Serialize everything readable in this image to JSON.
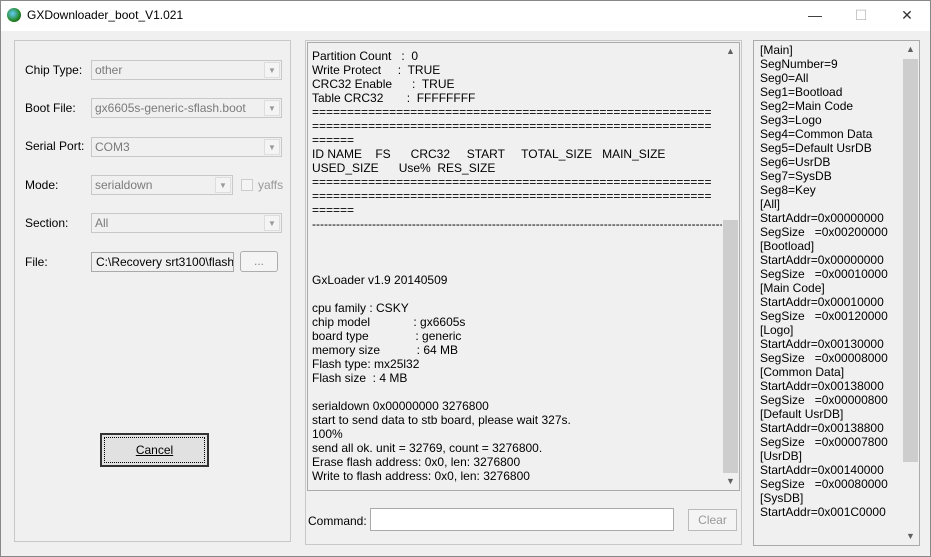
{
  "window": {
    "title": "GXDownloader_boot_V1.021",
    "minimize": "—",
    "maximize": "☐",
    "close": "✕"
  },
  "form": {
    "chip_type": {
      "label": "Chip Type:",
      "value": "other"
    },
    "boot_file": {
      "label": "Boot File:",
      "value": "gx6605s-generic-sflash.boot"
    },
    "serial_port": {
      "label": "Serial Port:",
      "value": "COM3"
    },
    "mode": {
      "label": "Mode:",
      "value": "serialdown",
      "yaffs_label": "yaffs",
      "yaffs_checked": false
    },
    "section": {
      "label": "Section:",
      "value": "All"
    },
    "file": {
      "label": "File:",
      "value": "C:\\Recovery srt3100\\flash",
      "browse": "..."
    },
    "cancel": "Cancel"
  },
  "log": {
    "lines": [
      "Partition Count   :  0",
      "Write Protect     :  TRUE",
      "CRC32 Enable      :  TRUE",
      "Table CRC32       :  FFFFFFFF",
      "=========================================================",
      "=========================================================",
      "======",
      "ID NAME    FS      CRC32     START     TOTAL_SIZE   MAIN_SIZE",
      "USED_SIZE      Use%  RES_SIZE",
      "=========================================================",
      "=========================================================",
      "======",
      "-------------------------------------------------------------------------------------------------------------",
      "",
      "",
      "",
      "GxLoader v1.9 20140509",
      "",
      "cpu family : CSKY",
      "chip model             : gx6605s",
      "board type              : generic",
      "memory size           : 64 MB",
      "Flash type: mx25l32",
      "Flash size  : 4 MB",
      "",
      "serialdown 0x00000000 3276800",
      "start to send data to stb board, please wait 327s.",
      "100%",
      "send all ok. unit = 32769, count = 3276800.",
      "Erase flash address: 0x0, len: 3276800",
      "Write to flash address: 0x0, len: 3276800"
    ]
  },
  "command": {
    "label": "Command:",
    "value": "",
    "clear": "Clear"
  },
  "config": {
    "lines": [
      "[Main]",
      "SegNumber=9",
      "Seg0=All",
      "Seg1=Bootload",
      "Seg2=Main Code",
      "Seg3=Logo",
      "Seg4=Common Data",
      "Seg5=Default UsrDB",
      "Seg6=UsrDB",
      "Seg7=SysDB",
      "Seg8=Key",
      "[All]",
      "StartAddr=0x00000000",
      "SegSize   =0x00200000",
      "[Bootload]",
      "StartAddr=0x00000000",
      "SegSize   =0x00010000",
      "[Main Code]",
      "StartAddr=0x00010000",
      "SegSize   =0x00120000",
      "[Logo]",
      "StartAddr=0x00130000",
      "SegSize   =0x00008000",
      "[Common Data]",
      "StartAddr=0x00138000",
      "SegSize   =0x00000800",
      "[Default UsrDB]",
      "StartAddr=0x00138800",
      "SegSize   =0x00007800",
      "[UsrDB]",
      "StartAddr=0x00140000",
      "SegSize   =0x00080000",
      "[SysDB]",
      "StartAddr=0x001C0000"
    ]
  }
}
